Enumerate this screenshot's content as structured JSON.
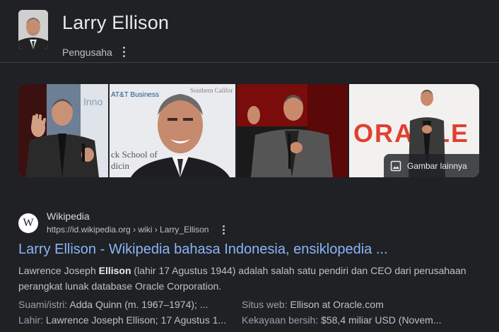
{
  "header": {
    "title": "Larry Ellison",
    "subtitle": "Pengusaha",
    "menu_icon": "more-vert-icon"
  },
  "images": {
    "more_label": "Gambar lainnya",
    "tile_texts": {
      "tile1": "Inno",
      "tile2_a": "AT&T Business",
      "tile2_b": "Southern Califor",
      "tile2_c": "ck School of",
      "tile2_d": "dicin",
      "tile4": "ORACLE"
    }
  },
  "result": {
    "site_name": "Wikipedia",
    "site_icon": "W",
    "url": "https://id.wikipedia.org › wiki › Larry_Ellison",
    "title": "Larry Ellison - Wikipedia bahasa Indonesia, ensiklopedia ...",
    "snippet_before": "Lawrence Joseph ",
    "snippet_bold": "Ellison",
    "snippet_after": " (lahir 17 Agustus 1944) adalah salah satu pendiri dan CEO dari perusahaan perangkat lunak database Oracle Corporation.",
    "facts": [
      {
        "key": "Suami/istri:",
        "value": "Adda Quinn (m. 1967–1974); ..."
      },
      {
        "key": "Situs web:",
        "value": "Ellison at Oracle.com"
      },
      {
        "key": "Lahir:",
        "value": "Lawrence Joseph Ellison; 17 Agustus 1..."
      },
      {
        "key": "Kekayaan bersih:",
        "value": "$58,4 miliar USD (Novem..."
      }
    ]
  },
  "colors": {
    "background": "#202124",
    "link": "#8ab4f8",
    "text_primary": "#e8eaed",
    "text_secondary": "#bdc1c6",
    "oracle_red": "#e0402f"
  }
}
